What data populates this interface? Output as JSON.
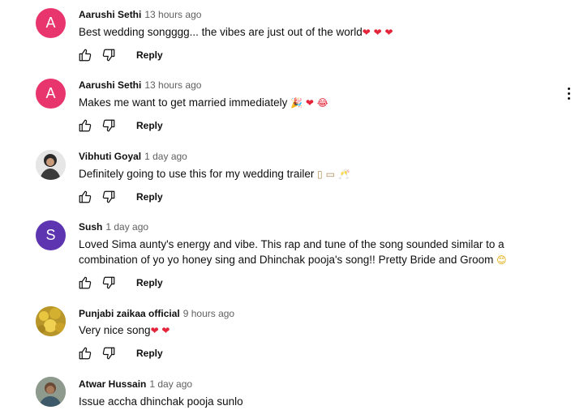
{
  "actions": {
    "reply_label": "Reply"
  },
  "comments": [
    {
      "author": "Aarushi Sethi",
      "time": "13 hours ago",
      "text": "Best wedding songggg... the vibes are just out of the world",
      "emoji": "❤ ❤ ❤",
      "avatar_letter": "A",
      "avatar_color": "#e8356d"
    },
    {
      "author": "Aarushi Sethi",
      "time": "13 hours ago",
      "text": "Makes me want to get married immediately",
      "emoji": "🎉 ❤ 😂",
      "avatar_letter": "A",
      "avatar_color": "#e8356d"
    },
    {
      "author": "Vibhuti Goyal",
      "time": "1 day ago",
      "text": "Definitely going to use this for my wedding trailer",
      "emoji": "▯ ▭ 🥂",
      "avatar_letter": "",
      "avatar_color": "#3a3a3a"
    },
    {
      "author": "Sush",
      "time": "1 day ago",
      "text": "Loved Sima aunty's energy and vibe. This rap and tune of the song sounded similar to a combination of yo yo honey sing and Dhinchak pooja's song!! Pretty Bride and Groom",
      "emoji": "😊",
      "avatar_letter": "S",
      "avatar_color": "#5e35b1"
    },
    {
      "author": "Punjabi zaikaa official",
      "time": "9 hours ago",
      "text": "Very nice song",
      "emoji": "❤ ❤",
      "avatar_letter": "",
      "avatar_color": "#c9a227"
    },
    {
      "author": "Atwar Hussain",
      "time": "1 day ago",
      "text": "Issue accha dhinchak pooja sunlo",
      "emoji": "",
      "avatar_letter": "",
      "avatar_color": "#7a8a7a"
    }
  ]
}
